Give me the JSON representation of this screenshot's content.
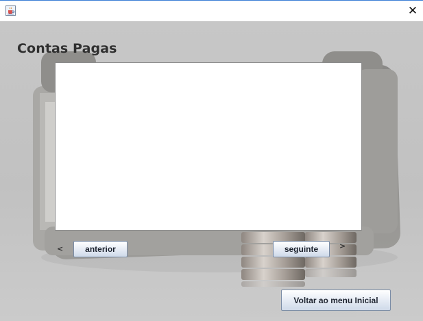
{
  "window": {
    "app_icon": "java-cup-icon",
    "close_icon": "close-icon",
    "close_glyph": "✕"
  },
  "page": {
    "title": "Contas Pagas"
  },
  "navigation": {
    "prev_arrow": "<",
    "prev_label": "anterior",
    "next_label": "seguinte",
    "next_arrow": ">"
  },
  "footer": {
    "home_label": "Voltar ao menu Inicial"
  },
  "colors": {
    "background": "#c4c4c4",
    "titlebar_border": "#3c7fd6",
    "button_border": "#7a8ca6",
    "list_background": "#ffffff"
  }
}
